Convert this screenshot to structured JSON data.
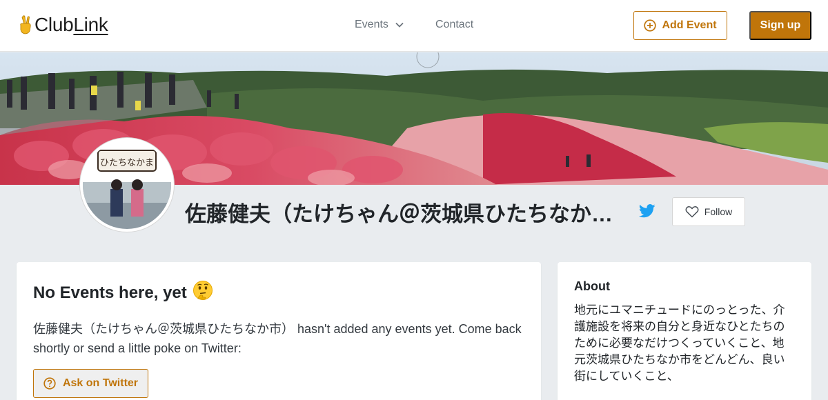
{
  "header": {
    "logo_prefix": "Club",
    "logo_underlined": "Link",
    "logo_icon": "victory-hand-icon",
    "nav_events": "Events",
    "nav_contact": "Contact",
    "add_event": "Add Event",
    "sign_up": "Sign up"
  },
  "profile": {
    "name": "佐藤健夫（たけちゃん＠茨城県ひたちなか市）",
    "follow_label": "Follow",
    "avatar_caption": "ひたちなかま"
  },
  "events": {
    "title": "No Events here, yet",
    "emoji": "🤔",
    "message": "佐藤健夫（たけちゃん＠茨城県ひたちなか市） hasn't added any events yet. Come back shortly or send a little poke on Twitter:",
    "ask_button": "Ask on Twitter"
  },
  "about": {
    "title": "About",
    "text": "地元にユマニチュードにのっとった、介護施設を将来の自分と身近なひとたちのために必要なだけつくっていくこと、地元茨城県ひたちなか市をどんどん、良い街にしていくこと、"
  },
  "colors": {
    "accent": "#c0750a",
    "twitter": "#1da1f2",
    "page_background": "#e9ecef"
  }
}
